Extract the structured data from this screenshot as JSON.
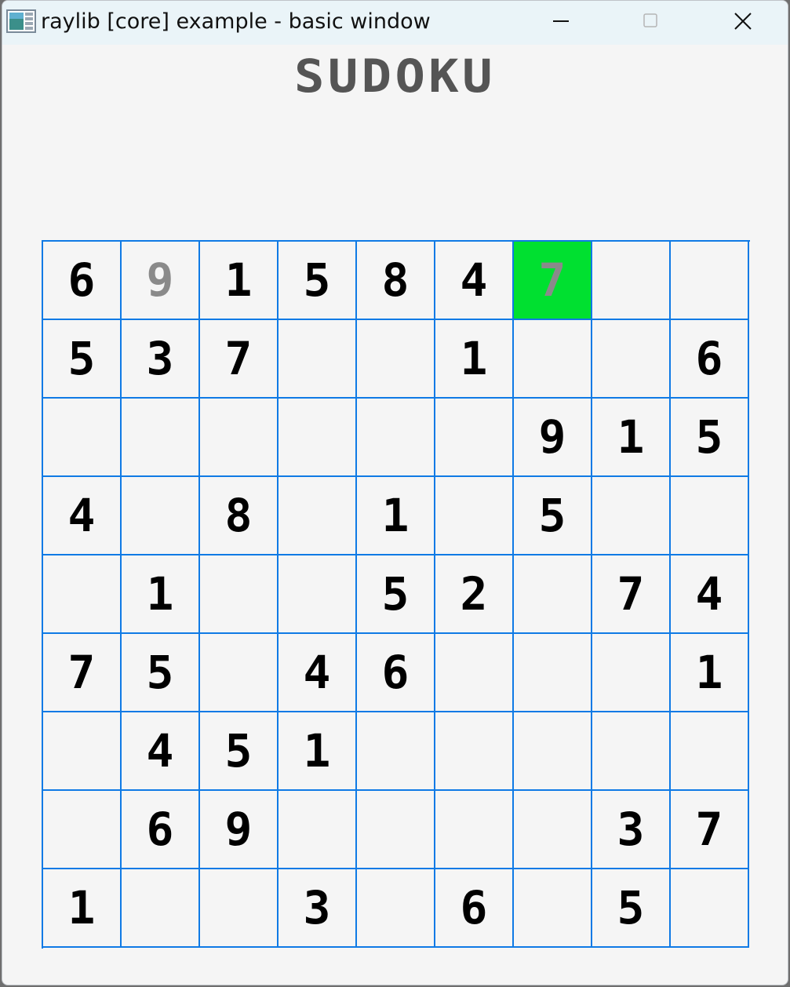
{
  "window": {
    "title": "raylib [core] example - basic window",
    "icon": "raylib-app-icon"
  },
  "controls": {
    "minimize_icon": "minimize-icon",
    "maximize_icon": "maximize-icon",
    "close_icon": "close-icon"
  },
  "game": {
    "title": "SUDOKU"
  },
  "colors": {
    "grid_line": "#0f7ae5",
    "selected_cell": "#00e030",
    "given_digit": "#000000",
    "hint_digit": "#8a8a8a",
    "title": "#555555"
  },
  "board": {
    "rows": [
      [
        "6",
        "9",
        "1",
        "5",
        "8",
        "4",
        "7",
        "",
        ""
      ],
      [
        "5",
        "3",
        "7",
        "",
        "",
        "1",
        "",
        "",
        "6"
      ],
      [
        "",
        "",
        "",
        "",
        "",
        "",
        "9",
        "1",
        "5"
      ],
      [
        "4",
        "",
        "8",
        "",
        "1",
        "",
        "5",
        "",
        ""
      ],
      [
        "",
        "1",
        "",
        "",
        "5",
        "2",
        "",
        "7",
        "4"
      ],
      [
        "7",
        "5",
        "",
        "4",
        "6",
        "",
        "",
        "",
        "1"
      ],
      [
        "",
        "4",
        "5",
        "1",
        "",
        "",
        "",
        "",
        ""
      ],
      [
        "",
        "6",
        "9",
        "",
        "",
        "",
        "",
        "3",
        "7"
      ],
      [
        "1",
        "",
        "",
        "3",
        "",
        "6",
        "",
        "5",
        ""
      ]
    ],
    "hint_cells": [
      [
        0,
        1
      ],
      [
        0,
        6
      ]
    ],
    "selected_cell": [
      0,
      6
    ]
  }
}
